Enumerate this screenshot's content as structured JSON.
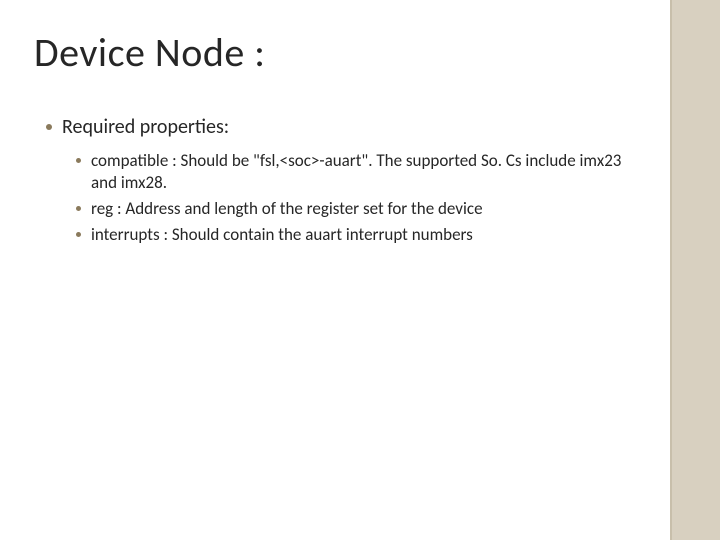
{
  "title": "Device Node :",
  "bullets": {
    "lvl1": "Required properties:",
    "items": [
      "compatible : Should be \"fsl,<soc>-auart\". The supported So. Cs include imx23 and imx28.",
      " reg : Address and length of the register set for the device",
      " interrupts : Should contain the auart interrupt numbers"
    ]
  }
}
